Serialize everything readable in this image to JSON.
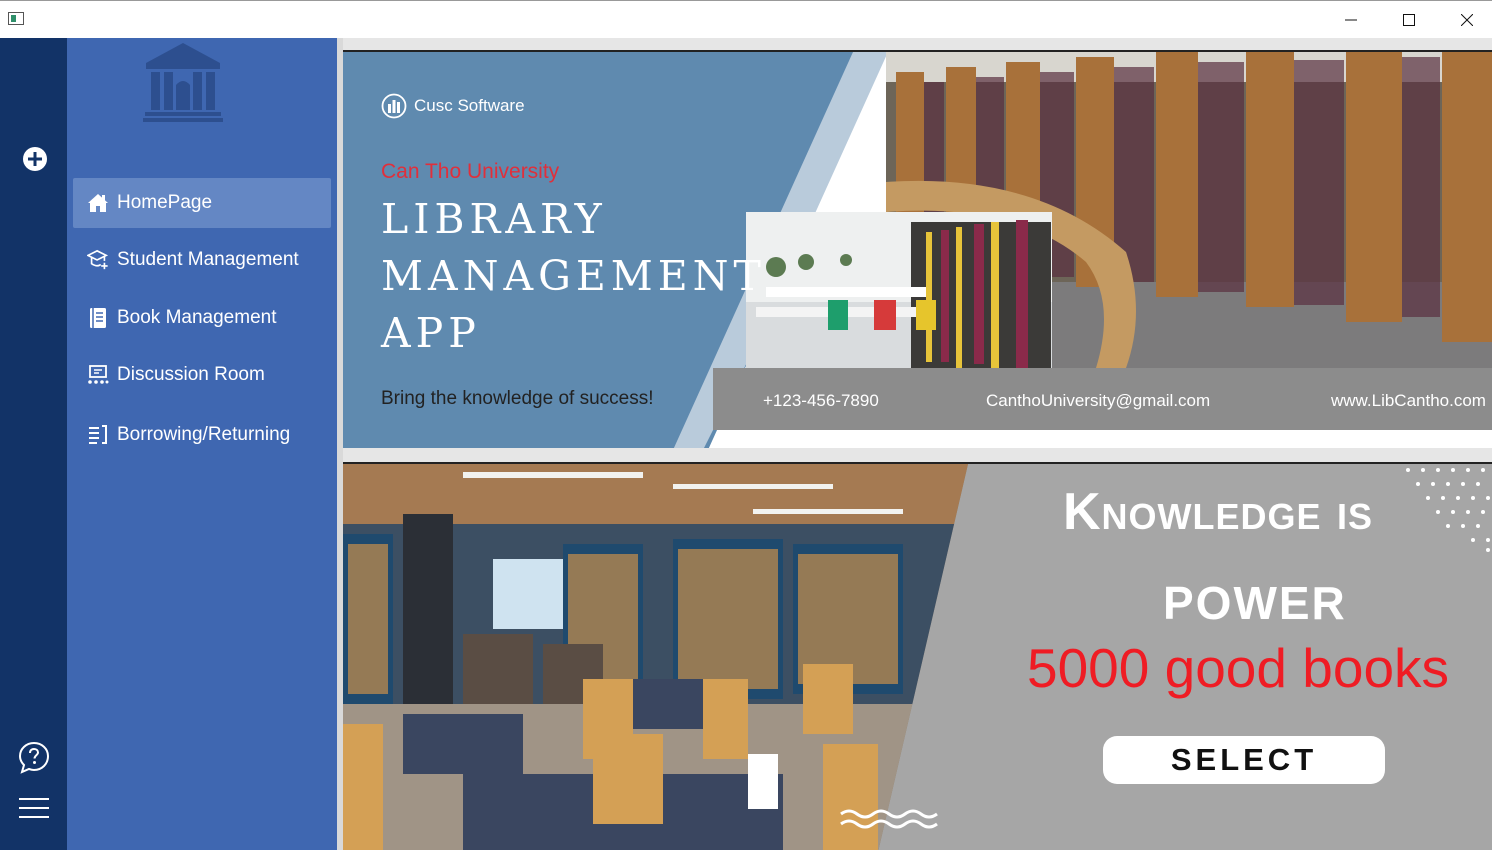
{
  "window": {
    "title": "",
    "controls": {
      "minimize": "minimize-icon",
      "maximize": "maximize-icon",
      "close": "close-icon"
    }
  },
  "rail": {
    "add_icon": "plus-circle-icon",
    "help_icon": "help-chat-icon",
    "menu_icon": "hamburger-menu-icon"
  },
  "sidebar": {
    "logo_icon": "library-building-icon",
    "items": [
      {
        "label": "HomePage",
        "icon": "home-icon",
        "active": true
      },
      {
        "label": "Student Management",
        "icon": "graduation-cap-icon",
        "active": false
      },
      {
        "label": "Book Management",
        "icon": "book-icon",
        "active": false
      },
      {
        "label": "Discussion Room",
        "icon": "discussion-room-icon",
        "active": false
      },
      {
        "label": "Borrowing/Returning",
        "icon": "borrow-list-icon",
        "active": false
      }
    ]
  },
  "banner1": {
    "brand": "Cusc Software",
    "university": "Can Tho University",
    "title_lines": [
      "LIBRARY",
      "MANAGEMENT",
      "APP"
    ],
    "tagline": "Bring the knowledge of success!",
    "phone": "+123-456-7890",
    "email": "CanthoUniversity@gmail.com",
    "website": "www.LibCantho.com"
  },
  "banner2": {
    "headline_1": "Knowledge is",
    "headline_2": "POWER",
    "books_text": "5000 good books",
    "button_label": "SELECT"
  },
  "colors": {
    "rail": "#123367",
    "sidebar": "#3f67b1",
    "sidebar_active": "#6487c4",
    "banner_blue": "#5f8aaf",
    "accent_red": "#e02f3b",
    "banner2_grey": "#a6a6a6"
  }
}
